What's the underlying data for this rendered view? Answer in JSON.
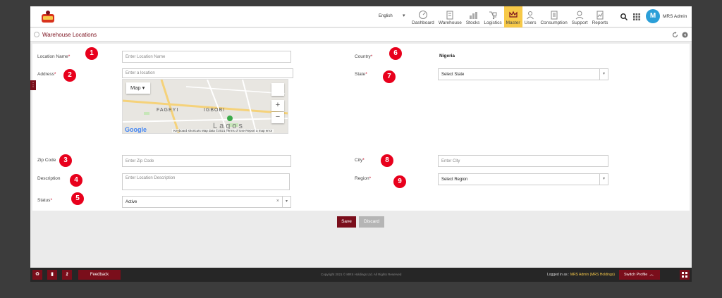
{
  "header": {
    "language": "English",
    "nav": [
      {
        "label": "Dashboard",
        "icon": "dashboard-icon"
      },
      {
        "label": "Warehouse",
        "icon": "warehouse-icon"
      },
      {
        "label": "Stocks",
        "icon": "stocks-icon"
      },
      {
        "label": "Logistics",
        "icon": "logistics-icon"
      },
      {
        "label": "Master",
        "icon": "crown-icon",
        "active": true
      },
      {
        "label": "Users",
        "icon": "users-icon"
      },
      {
        "label": "Consumption",
        "icon": "consumption-icon"
      },
      {
        "label": "Support",
        "icon": "support-icon"
      },
      {
        "label": "Reports",
        "icon": "reports-icon"
      }
    ],
    "avatar_letter": "M",
    "username": "MRS Admin"
  },
  "page": {
    "title": "Warehouse Locations"
  },
  "form": {
    "location_name": {
      "label": "Location Name",
      "placeholder": "Enter Location Name",
      "badge": "1"
    },
    "address": {
      "label": "Address",
      "placeholder": "Enter a location",
      "badge": "2"
    },
    "zip_code": {
      "label": "Zip Code",
      "placeholder": "Enter Zip Code",
      "badge": "3"
    },
    "description": {
      "label": "Description",
      "placeholder": "Enter Location Description",
      "badge": "4"
    },
    "status": {
      "label": "Status",
      "value": "Active",
      "badge": "5"
    },
    "country": {
      "label": "Country",
      "value": "Nigeria",
      "badge": "6"
    },
    "state": {
      "label": "State",
      "value": "Select State",
      "badge": "7"
    },
    "city": {
      "label": "City",
      "placeholder": "Enter City",
      "badge": "8"
    },
    "region": {
      "label": "Region",
      "value": "Select Region",
      "badge": "9"
    }
  },
  "map": {
    "type_button": "Map",
    "labels": [
      "FAGEYI",
      "IGBOBI",
      "Lagos"
    ],
    "brand": "Google",
    "footer": "Keyboard shortcuts   Map data ©2021   Terms of Use   Report a map error"
  },
  "actions": {
    "save": "Save",
    "discard": "Discard"
  },
  "footer": {
    "feedback": "Feedback",
    "copyright": "Copyright 2021 © MRS Holdings Ltd. All Rights Reserved",
    "logged_in_as": "Logged in as :",
    "logged_user": "MRS Admin (MRS Holdings)",
    "switch_profile": "Switch Profile"
  },
  "colors": {
    "brand": "#7a0e1b",
    "accent": "#f7c948",
    "badge": "#e8001c",
    "avatar": "#2b9fd8"
  }
}
